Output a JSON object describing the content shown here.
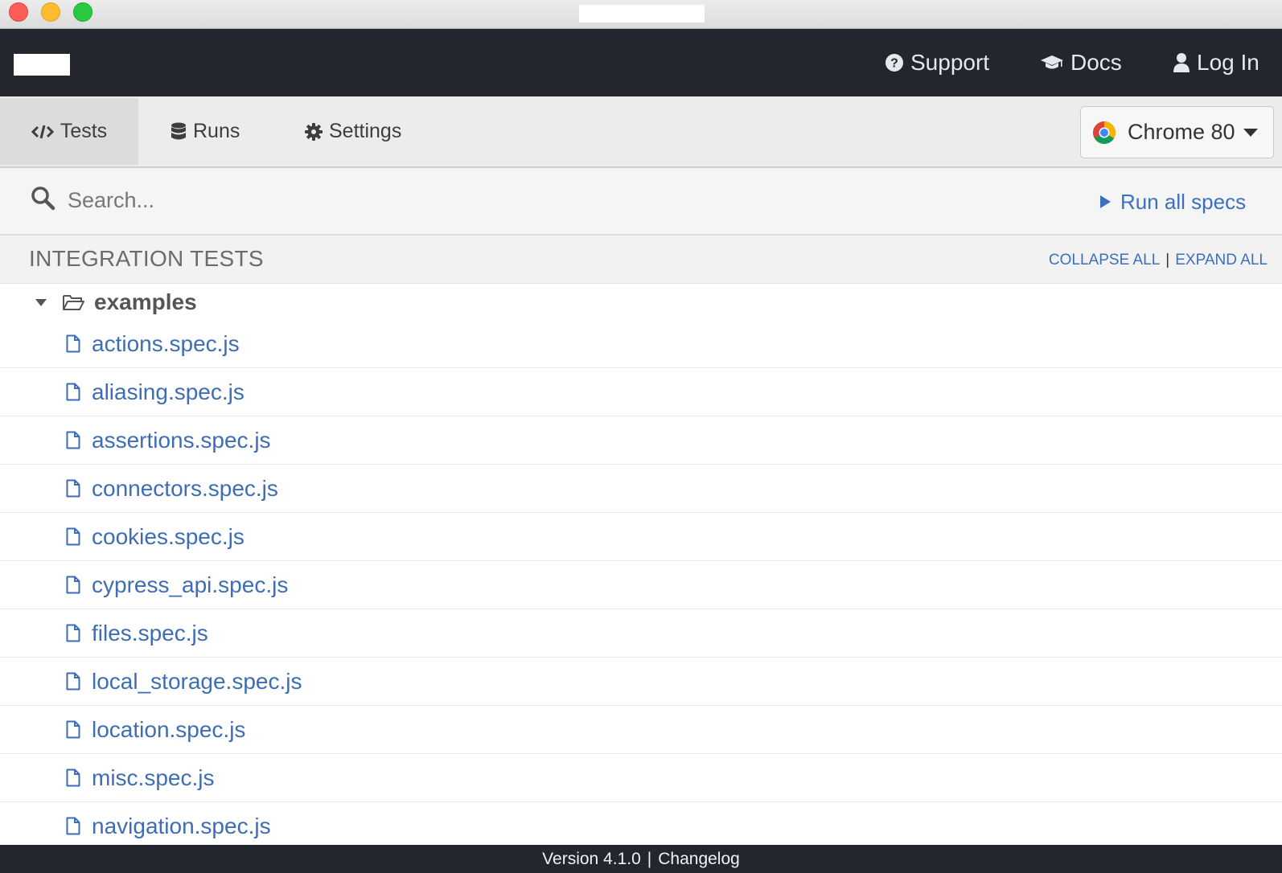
{
  "window": {
    "controls": [
      "close",
      "minimize",
      "maximize"
    ]
  },
  "topnav": {
    "support": "Support",
    "docs": "Docs",
    "login": "Log In",
    "icons": [
      "question-circle-icon",
      "graduation-cap-icon",
      "user-icon"
    ]
  },
  "tabs": [
    {
      "label": "Tests",
      "icon": "code-icon",
      "active": true
    },
    {
      "label": "Runs",
      "icon": "database-icon",
      "active": false
    },
    {
      "label": "Settings",
      "icon": "gear-icon",
      "active": false
    }
  ],
  "browser": {
    "label": "Chrome 80",
    "icon": "chrome-icon"
  },
  "search": {
    "placeholder": "Search...",
    "value": "",
    "run_all": "Run all specs"
  },
  "section": {
    "title": "INTEGRATION TESTS",
    "collapse_all": "COLLAPSE ALL",
    "separator": "|",
    "expand_all": "EXPAND ALL"
  },
  "folder": {
    "name": "examples",
    "expanded": true
  },
  "specs": [
    "actions.spec.js",
    "aliasing.spec.js",
    "assertions.spec.js",
    "connectors.spec.js",
    "cookies.spec.js",
    "cypress_api.spec.js",
    "files.spec.js",
    "local_storage.spec.js",
    "location.spec.js",
    "misc.spec.js",
    "navigation.spec.js"
  ],
  "footer": {
    "version": "Version 4.1.0",
    "separator": "|",
    "changelog": "Changelog"
  },
  "colors": {
    "nav_background": "#23262f",
    "link_blue": "#3e6db5",
    "tab_bar": "#ececec"
  }
}
